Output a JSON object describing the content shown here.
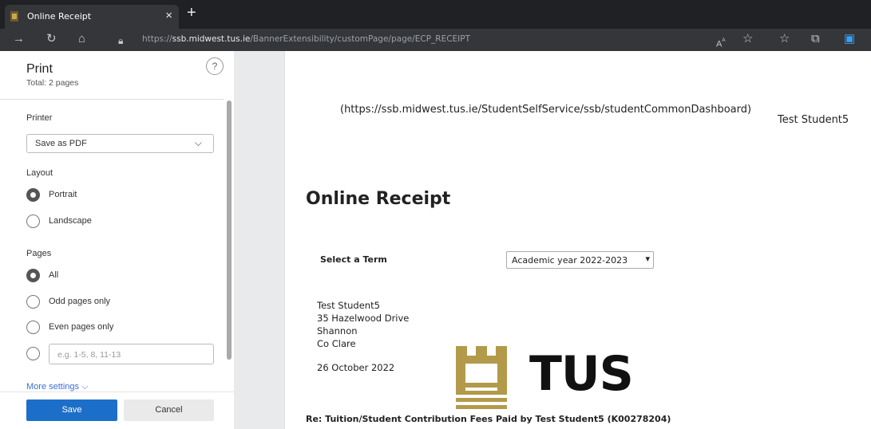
{
  "browser": {
    "tab_title": "Online Receipt",
    "tab_close": "×",
    "new_tab": "+",
    "url_scheme": "https://",
    "url_host": "ssb.midwest.tus.ie",
    "url_path": "/BannerExtensibility/customPage/page/ECP_RECEIPT"
  },
  "print_panel": {
    "title": "Print",
    "subtitle": "Total: 2 pages",
    "help": "?",
    "printer_label": "Printer",
    "printer_value": "Save as PDF",
    "layout_label": "Layout",
    "layout_options": [
      "Portrait",
      "Landscape"
    ],
    "layout_selected": "Portrait",
    "pages_label": "Pages",
    "pages_options": [
      "All",
      "Odd pages only",
      "Even pages only"
    ],
    "pages_selected": "All",
    "custom_range_placeholder": "e.g. 1-5, 8, 11-13",
    "more_settings": "More settings ⌵",
    "save_label": "Save",
    "cancel_label": "Cancel"
  },
  "preview": {
    "dashboard_url": "(https://ssb.midwest.tus.ie/StudentSelfService/ssb/studentCommonDashboard)",
    "user_name": "Test Student5",
    "page_title": "Online Receipt",
    "term_label": "Select a Term",
    "term_value": "Academic year 2022-2023",
    "address": [
      "Test Student5",
      "35 Hazelwood Drive",
      "Shannon",
      "Co Clare"
    ],
    "date": "26 October 2022",
    "logo_text": "TUS",
    "re_line": "Re: Tuition/Student Contribution Fees Paid by Test Student5 (K00278204)"
  },
  "colors": {
    "tabbar": "#202124",
    "addressbar": "#35363a",
    "save_button": "#1c6fc8",
    "logo_gold": "#b39a4a"
  }
}
